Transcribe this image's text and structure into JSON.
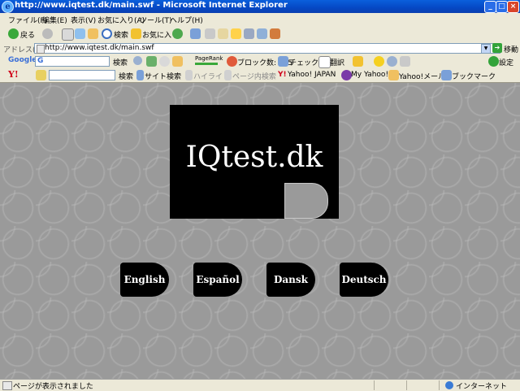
{
  "window": {
    "title": "http://www.iqtest.dk/main.swf - Microsoft Internet Explorer"
  },
  "menu": [
    "ファイル(F)",
    "編集(E)",
    "表示(V)",
    "お気に入り(A)",
    "ツール(T)",
    "ヘルプ(H)"
  ],
  "toolbar": {
    "back": "戻る",
    "search": "検索",
    "favorites": "お気に入り"
  },
  "address": {
    "label": "アドレス(D)",
    "url": "http://www.iqtest.dk/main.swf",
    "go": "移動"
  },
  "google_bar": {
    "brand": "Google",
    "search": "検索",
    "pagerank": "PageRank",
    "blocked": "ブロック数: 115",
    "check": "チェック",
    "translate": "翻訳",
    "settings": "設定"
  },
  "yahoo_bar": {
    "brand": "Y!",
    "search": "検索",
    "site_search": "サイト検索",
    "highlight": "ハイライト",
    "in_page": "ページ内検索",
    "japan": "Yahoo! JAPAN",
    "my_yahoo": "My Yahoo!",
    "mail": "Yahoo!メール",
    "bookmarks": "ブックマーク"
  },
  "main": {
    "logo": "IQtest.dk",
    "languages": [
      "English",
      "Español",
      "Dansk",
      "Deutsch"
    ]
  },
  "status": {
    "text": "ページが表示されました",
    "zone": "インターネット"
  },
  "colors": {
    "titlebar": "#0a5fdc",
    "chrome": "#ece9d8",
    "content_bg": "#9a9a9a",
    "button": "#000000"
  }
}
